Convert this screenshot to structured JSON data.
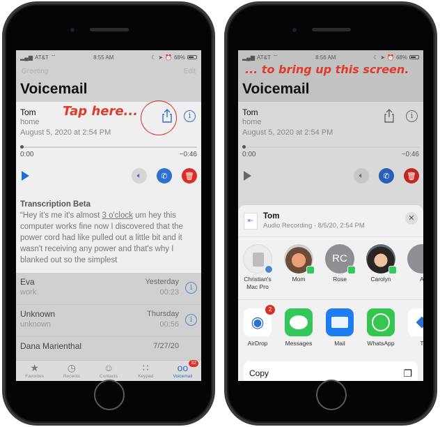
{
  "annotations": {
    "left": "Tap here...",
    "right": "... to bring up this screen."
  },
  "left_phone": {
    "status": {
      "carrier": "AT&T",
      "time": "8:55 AM",
      "battery": "68%"
    },
    "topbar": {
      "left": "Greeting",
      "right": "Edit"
    },
    "title": "Voicemail",
    "voicemail": {
      "name": "Tom",
      "label": "home",
      "date": "August 5, 2020 at 2:54 PM",
      "elapsed": "0:00",
      "remaining": "−0:46",
      "progress_fraction": 0.0
    },
    "transcription": {
      "title": "Transcription Beta",
      "text_before": "“Hey it's me it's almost ",
      "text_link": "3 o'clock",
      "text_after": " um hey this computer works fine now I discovered that the power cord had like pulled out a little bit and it wasn't receiving any power and that's why I blanked out so the simplest"
    },
    "list": [
      {
        "name": "Eva",
        "label": "work",
        "date": "Yesterday",
        "duration": "00:23"
      },
      {
        "name": "Unknown",
        "label": "unknown",
        "date": "Thursday",
        "duration": "00:56"
      },
      {
        "name": "Dana Marienthal",
        "label": "",
        "date": "7/27/20",
        "duration": ""
      }
    ],
    "tabs": [
      {
        "label": "Favorites",
        "icon": "★"
      },
      {
        "label": "Recents",
        "icon": "◷"
      },
      {
        "label": "Contacts",
        "icon": "☺"
      },
      {
        "label": "Keypad",
        "icon": "∷"
      },
      {
        "label": "Voicemail",
        "icon": "ᴑ",
        "badge": "32"
      }
    ]
  },
  "right_phone": {
    "status": {
      "carrier": "AT&T",
      "time": "8:56 AM",
      "battery": "68%"
    },
    "title": "Voicemail",
    "voicemail": {
      "name": "Tom",
      "label": "home",
      "date": "August 5, 2020 at 2:54 PM",
      "elapsed": "0:00",
      "remaining": "−0:46"
    },
    "share_sheet": {
      "title": "Tom",
      "subtitle": "Audio Recording · 8/5/20, 2:54 PM",
      "people": [
        {
          "name": "Christian's Mac Pro"
        },
        {
          "name": "Mom"
        },
        {
          "name": "Rose",
          "initials": "RC"
        },
        {
          "name": "Carolyn"
        },
        {
          "name": "A"
        }
      ],
      "apps": [
        {
          "name": "AirDrop",
          "badge": "2"
        },
        {
          "name": "Messages"
        },
        {
          "name": "Mail"
        },
        {
          "name": "WhatsApp"
        },
        {
          "name": "T"
        }
      ],
      "actions": [
        {
          "label": "Copy"
        }
      ]
    }
  }
}
